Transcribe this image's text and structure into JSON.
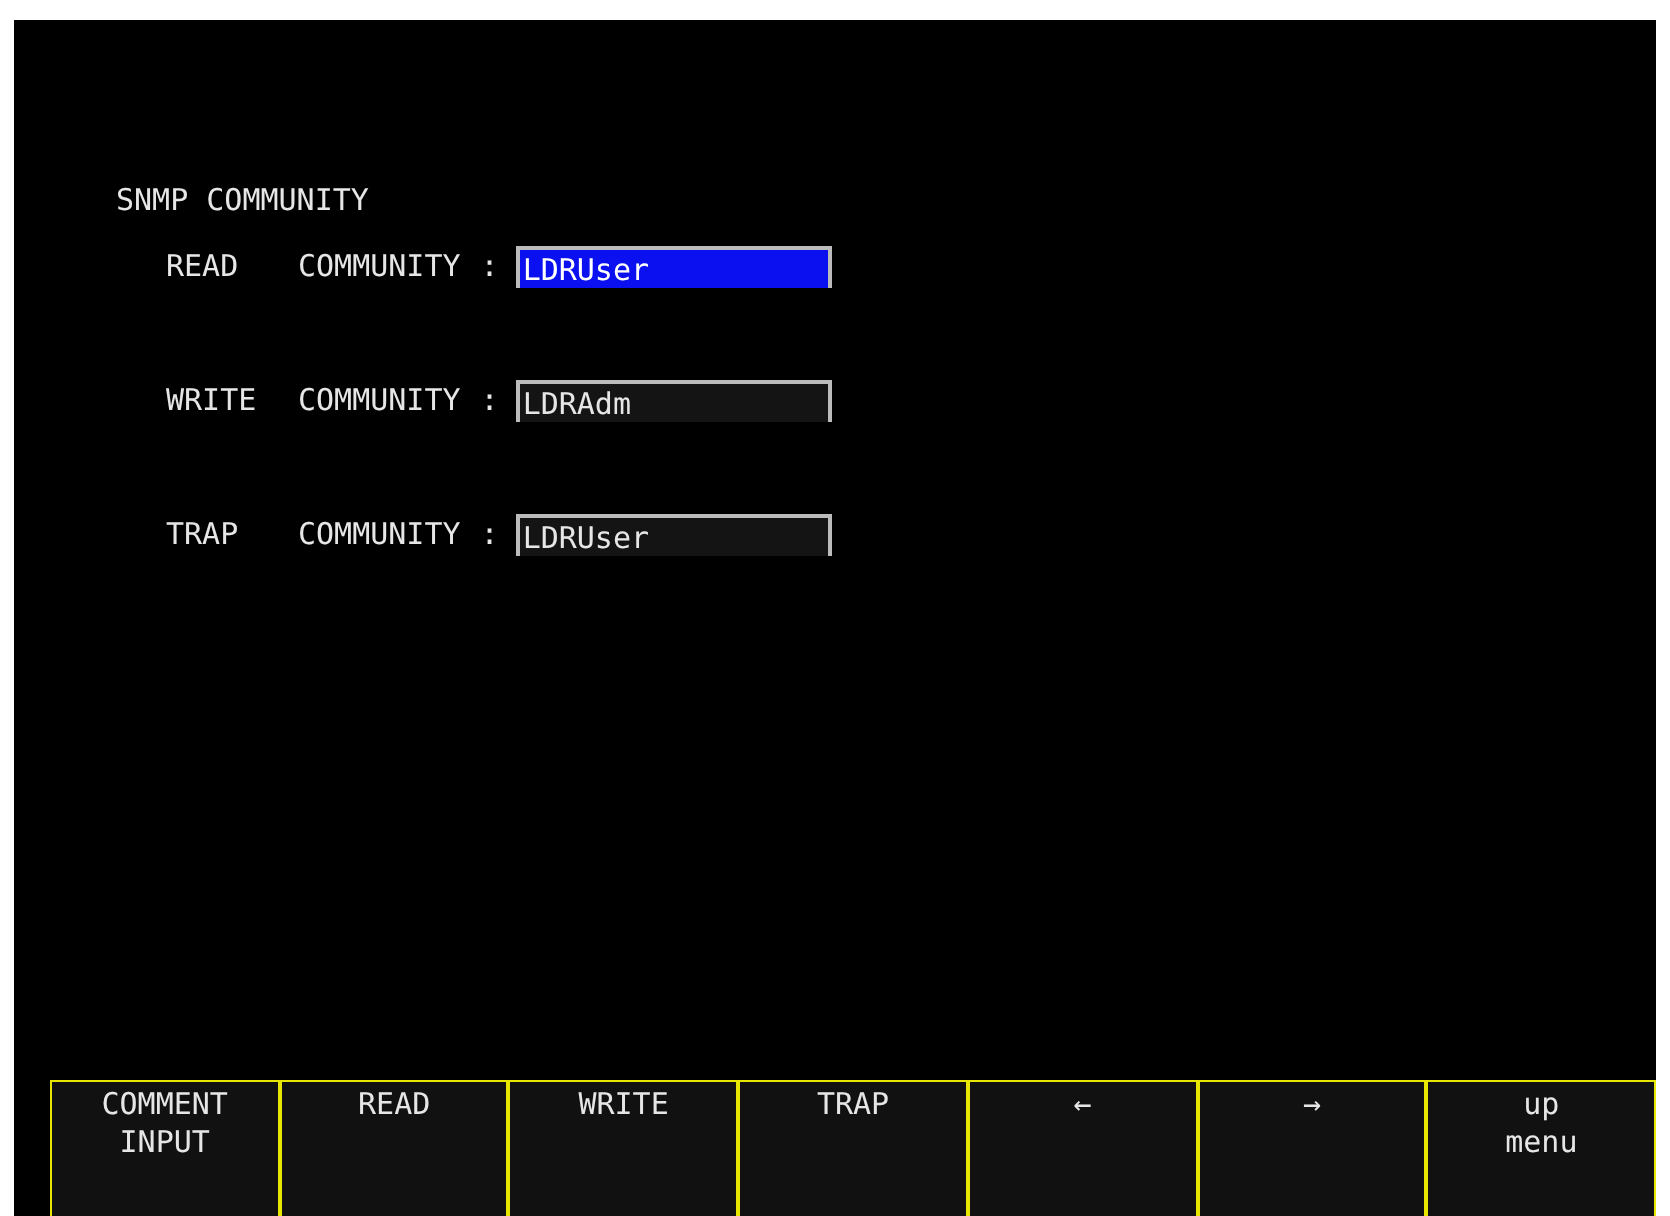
{
  "title": "SNMP COMMUNITY",
  "fields": [
    {
      "name": "READ",
      "label": "COMMUNITY",
      "separator": ":",
      "value": "LDRUser",
      "selected": true
    },
    {
      "name": "WRITE",
      "label": "COMMUNITY",
      "separator": ":",
      "value": "LDRAdm",
      "selected": false
    },
    {
      "name": "TRAP",
      "label": "COMMUNITY",
      "separator": ":",
      "value": "LDRUser",
      "selected": false
    }
  ],
  "softkeys": [
    {
      "lines": [
        "COMMENT",
        "INPUT"
      ]
    },
    {
      "lines": [
        "READ"
      ]
    },
    {
      "lines": [
        "WRITE"
      ]
    },
    {
      "lines": [
        "TRAP"
      ]
    },
    {
      "lines": [
        "←"
      ]
    },
    {
      "lines": [
        "→"
      ]
    },
    {
      "lines": [
        "up",
        "menu"
      ]
    }
  ]
}
